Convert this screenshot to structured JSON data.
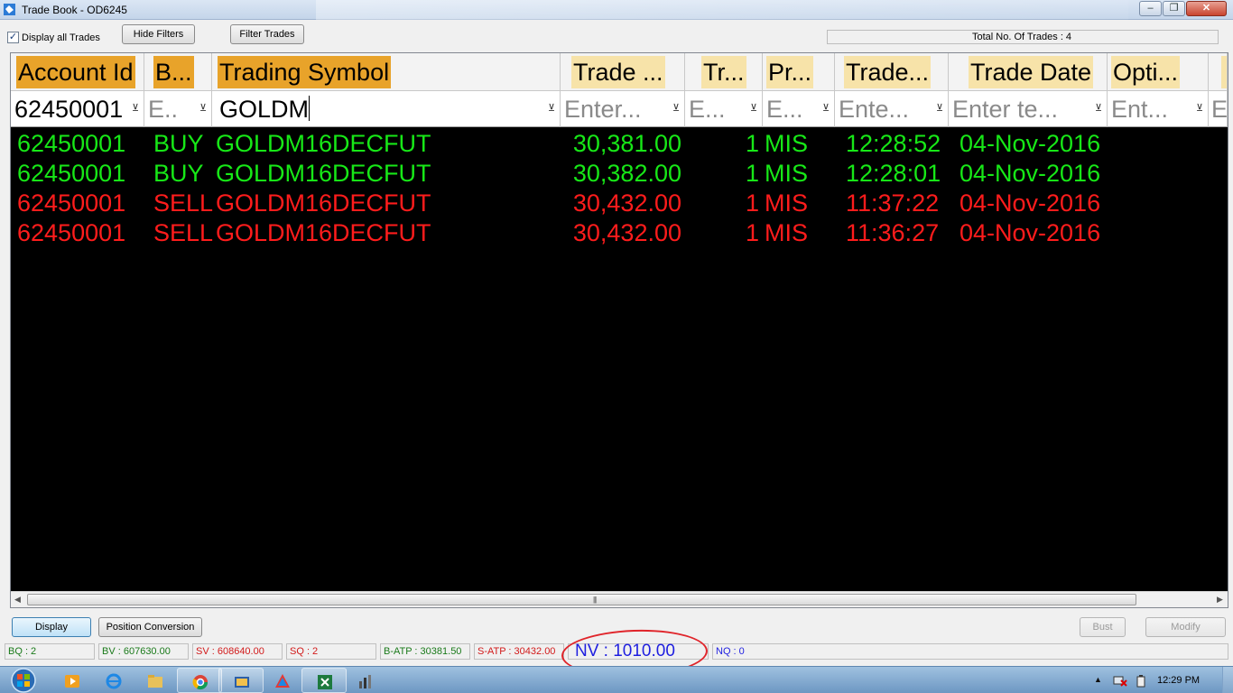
{
  "window": {
    "title": "Trade Book - OD6245",
    "buttons": {
      "minimize": "–",
      "restore": "❐",
      "close": "✕"
    }
  },
  "toolbar": {
    "display_all_trades_label": "Display all Trades",
    "display_all_trades_checked": true,
    "hide_filters_label": "Hide Filters",
    "filter_trades_label": "Filter Trades",
    "total_trades_text": "Total No. Of Trades : 4"
  },
  "grid": {
    "columns": [
      {
        "header": "Account Id",
        "filter": "62450001",
        "filter_is_placeholder": false
      },
      {
        "header": "B...",
        "filter": "E..",
        "filter_is_placeholder": true
      },
      {
        "header": "Trading Symbol",
        "filter": "GOLDM",
        "filter_is_placeholder": false
      },
      {
        "header": "Trade ...",
        "filter": "Enter...",
        "filter_is_placeholder": true
      },
      {
        "header": "Tr...",
        "filter": "E...",
        "filter_is_placeholder": true
      },
      {
        "header": "Pr...",
        "filter": "E...",
        "filter_is_placeholder": true
      },
      {
        "header": "Trade...",
        "filter": "Ente...",
        "filter_is_placeholder": true
      },
      {
        "header": "Trade Date",
        "filter": "Enter te...",
        "filter_is_placeholder": true
      },
      {
        "header": "Opti...",
        "filter": "Ent...",
        "filter_is_placeholder": true
      },
      {
        "header": "",
        "filter": "E",
        "filter_is_placeholder": true
      }
    ],
    "rows": [
      {
        "account": "62450001",
        "side": "BUY",
        "symbol": "GOLDM16DECFUT",
        "price": "30,381.00",
        "qty": "1",
        "product": "MIS",
        "time": "12:28:52",
        "date": "04-Nov-2016"
      },
      {
        "account": "62450001",
        "side": "BUY",
        "symbol": "GOLDM16DECFUT",
        "price": "30,382.00",
        "qty": "1",
        "product": "MIS",
        "time": "12:28:01",
        "date": "04-Nov-2016"
      },
      {
        "account": "62450001",
        "side": "SELL",
        "symbol": "GOLDM16DECFUT",
        "price": "30,432.00",
        "qty": "1",
        "product": "MIS",
        "time": "11:37:22",
        "date": "04-Nov-2016"
      },
      {
        "account": "62450001",
        "side": "SELL",
        "symbol": "GOLDM16DECFUT",
        "price": "30,432.00",
        "qty": "1",
        "product": "MIS",
        "time": "11:36:27",
        "date": "04-Nov-2016"
      }
    ],
    "colors": {
      "buy": "#17e817",
      "sell": "#ff1c1c",
      "background": "#000000",
      "header_accent": "#e8a32a"
    }
  },
  "bottom": {
    "display_label": "Display",
    "position_conversion_label": "Position Conversion",
    "bust_label": "Bust",
    "modify_label": "Modify"
  },
  "status": {
    "bq": "BQ : 2",
    "bv": "BV : 607630.00",
    "sv": "SV : 608640.00",
    "sq": "SQ : 2",
    "b_atp": "B-ATP : 30381.50",
    "s_atp": "S-ATP : 30432.00",
    "nv": "NV : 1010.00",
    "nq": "NQ : 0"
  },
  "taskbar": {
    "clock": "12:29 PM",
    "tray_arrow": "▲"
  }
}
